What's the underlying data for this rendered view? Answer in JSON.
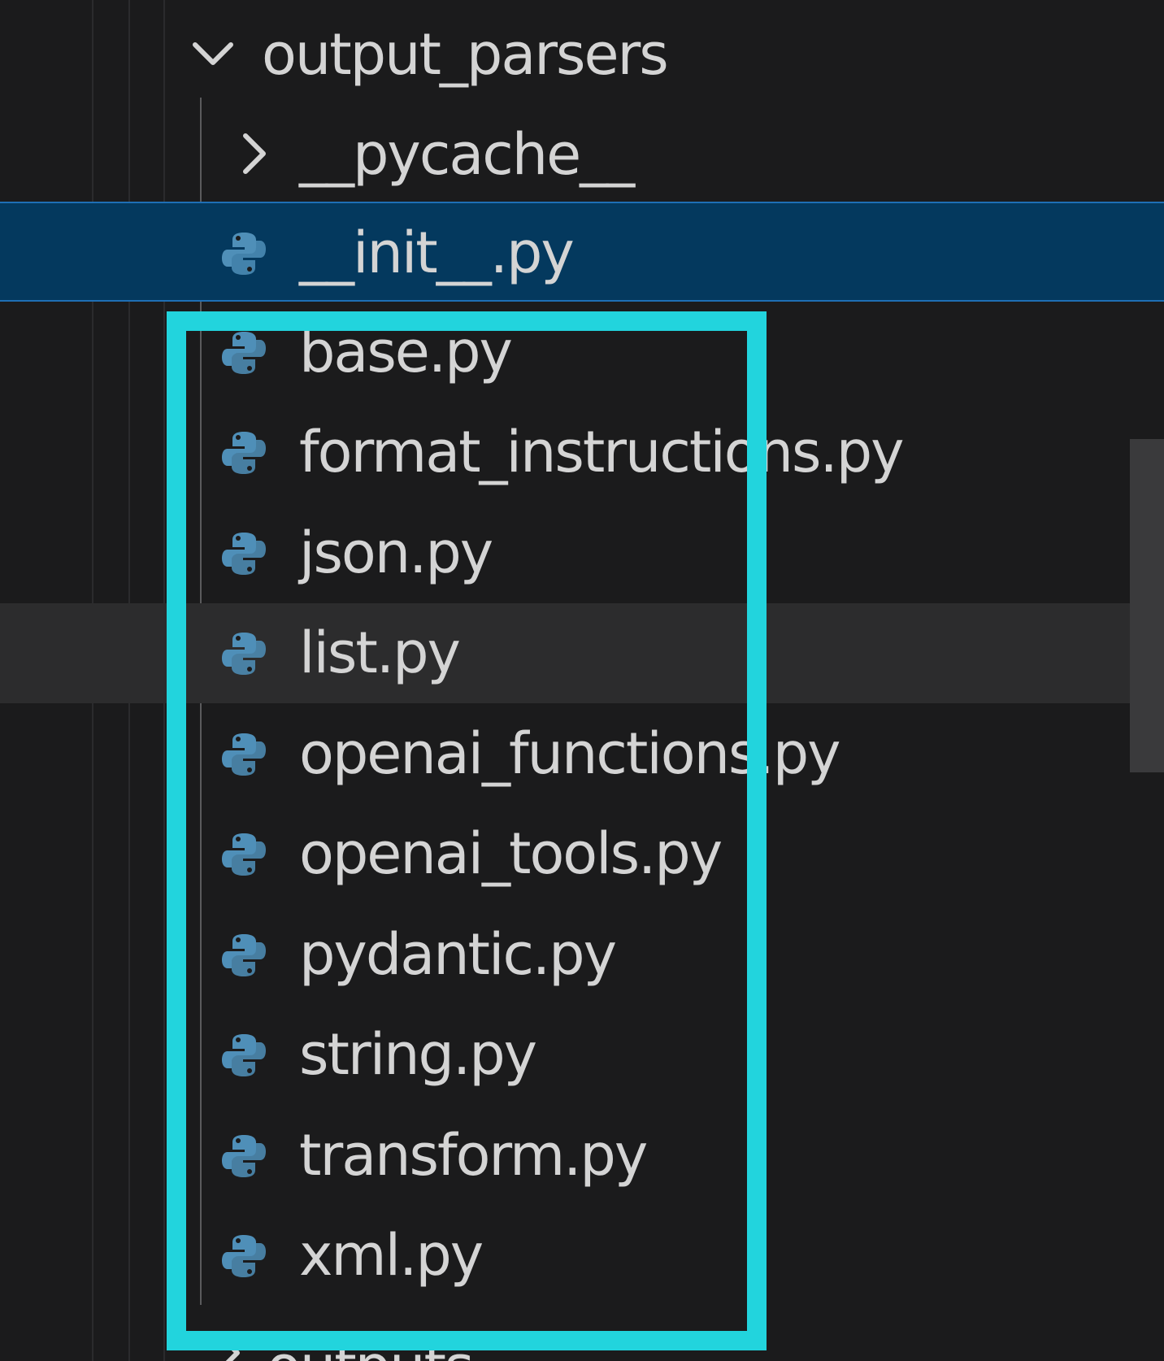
{
  "tree": {
    "folder": {
      "name": "output_parsers",
      "expanded": true
    },
    "subfolder": {
      "name": "__pycache__",
      "expanded": false
    },
    "files": [
      {
        "name": "__init__.py",
        "icon": "python-icon",
        "selected": true
      },
      {
        "name": "base.py",
        "icon": "python-icon"
      },
      {
        "name": "format_instructions.py",
        "icon": "python-icon"
      },
      {
        "name": "json.py",
        "icon": "python-icon"
      },
      {
        "name": "list.py",
        "icon": "python-icon",
        "hovered": true
      },
      {
        "name": "openai_functions.py",
        "icon": "python-icon"
      },
      {
        "name": "openai_tools.py",
        "icon": "python-icon"
      },
      {
        "name": "pydantic.py",
        "icon": "python-icon"
      },
      {
        "name": "string.py",
        "icon": "python-icon"
      },
      {
        "name": "transform.py",
        "icon": "python-icon"
      },
      {
        "name": "xml.py",
        "icon": "python-icon"
      }
    ],
    "next_folder": {
      "name": "outputs",
      "expanded": false
    }
  },
  "colors": {
    "background": "#1b1b1c",
    "selection": "#04395e",
    "hover": "#2c2c2d",
    "highlight_box": "#22d4dd",
    "python_blue": "#4f8fb8"
  }
}
